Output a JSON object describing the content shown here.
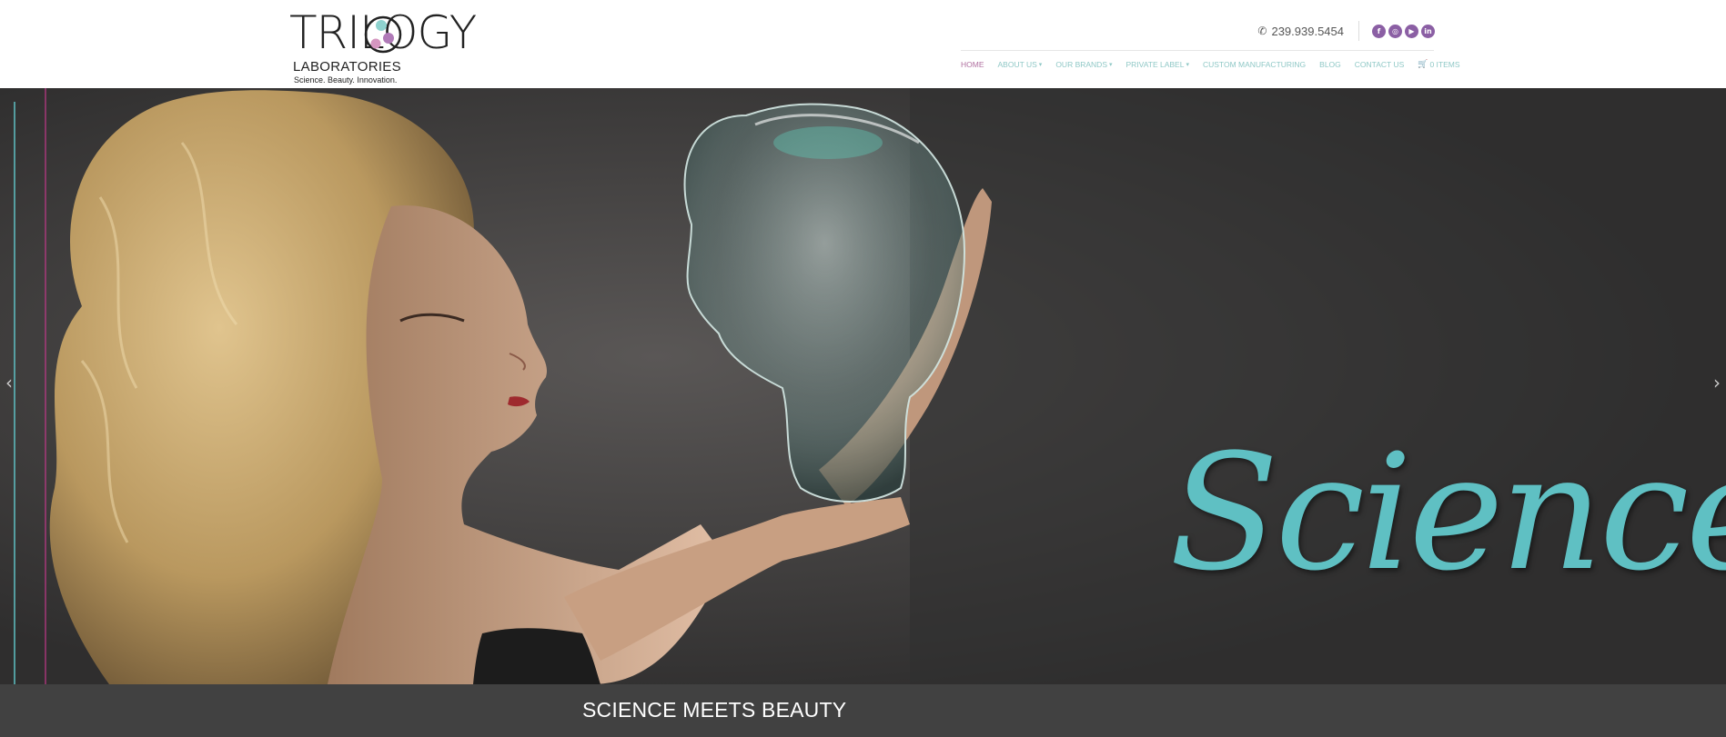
{
  "brand": {
    "logo_word": "TRILOGY",
    "logo_sub": "LABORATORIES",
    "logo_tagline": "Science. Beauty. Innovation.",
    "dot_colors": [
      "#8fd3cf",
      "#b07ab8",
      "#d596c0"
    ]
  },
  "topbar": {
    "phone": "239.939.5454",
    "phone_icon": "phone-icon",
    "socials": [
      {
        "name": "facebook-icon",
        "glyph": "f"
      },
      {
        "name": "instagram-icon",
        "glyph": "◎"
      },
      {
        "name": "youtube-icon",
        "glyph": "▶"
      },
      {
        "name": "linkedin-icon",
        "glyph": "in"
      }
    ]
  },
  "nav": {
    "items": [
      {
        "label": "HOME",
        "dropdown": false,
        "active": true
      },
      {
        "label": "ABOUT US",
        "dropdown": true,
        "active": false
      },
      {
        "label": "OUR BRANDS",
        "dropdown": true,
        "active": false
      },
      {
        "label": "PRIVATE LABEL",
        "dropdown": true,
        "active": false
      },
      {
        "label": "CUSTOM MANUFACTURING",
        "dropdown": false,
        "active": false
      },
      {
        "label": "BLOG",
        "dropdown": false,
        "active": false
      },
      {
        "label": "CONTACT US",
        "dropdown": false,
        "active": false
      }
    ],
    "cart_label": "0 ITEMS",
    "cart_icon": "cart-icon"
  },
  "hero": {
    "script_text": "Science",
    "arrow_left": "‹",
    "arrow_right": "›",
    "accent_teal": "#5fc0c3",
    "accent_magenta": "#c2398a"
  },
  "caption": {
    "text": "SCIENCE MEETS BEAUTY"
  }
}
